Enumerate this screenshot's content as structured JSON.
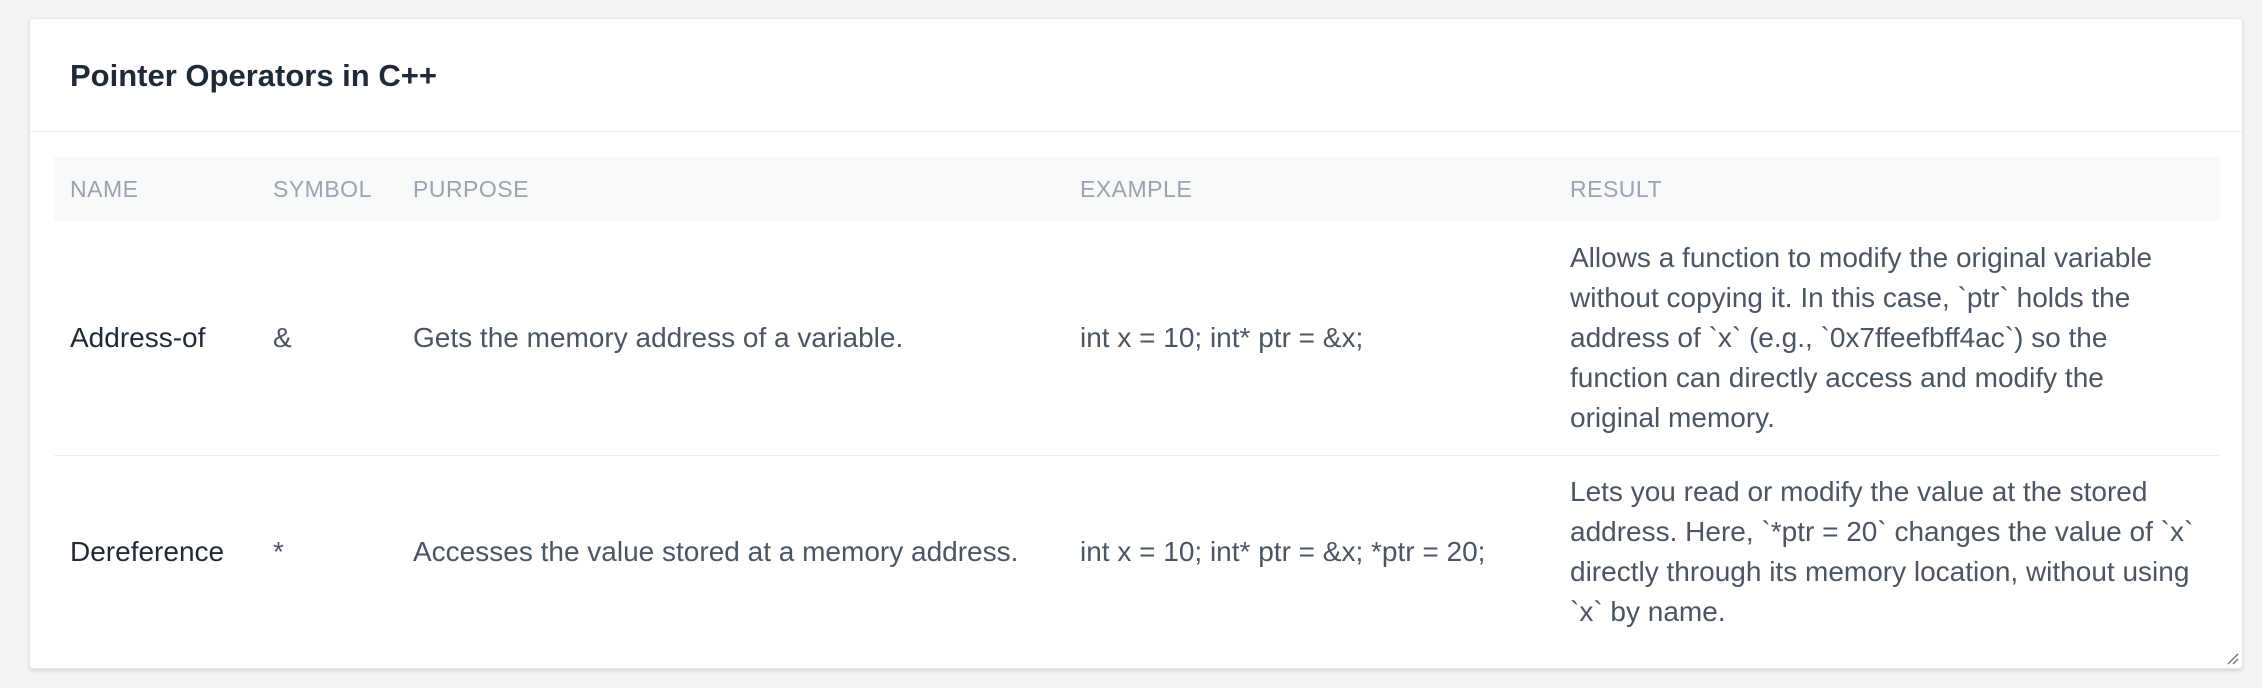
{
  "card": {
    "title": "Pointer Operators in C++"
  },
  "table": {
    "headers": [
      "NAME",
      "SYMBOL",
      "PURPOSE",
      "EXAMPLE",
      "RESULT"
    ],
    "rows": [
      {
        "name": "Address-of",
        "symbol": "&",
        "purpose": "Gets the memory address of a variable.",
        "example": "int x = 10; int* ptr = &x;",
        "result": "Allows a function to modify the original variable without copying it. In this case, `ptr` holds the address of `x` (e.g., `0x7ffeefbff4ac`) so the function can directly access and modify the original memory."
      },
      {
        "name": "Dereference",
        "symbol": "*",
        "purpose": "Accesses the value stored at a memory address.",
        "example": "int x = 10; int* ptr = &x; *ptr = 20;",
        "result": "Lets you read or modify the value at the stored address. Here, `*ptr = 20` changes the value of `x` directly through its memory location, without using `x` by name."
      }
    ]
  },
  "icons": {
    "resize_handle": "resize-grip-icon"
  },
  "colors": {
    "background": "#f3f4f6",
    "card": "#ffffff",
    "header_row": "#f8f9fb",
    "header_text": "#9aa3af",
    "title_text": "#1f2937",
    "body_text": "#4b5563"
  }
}
